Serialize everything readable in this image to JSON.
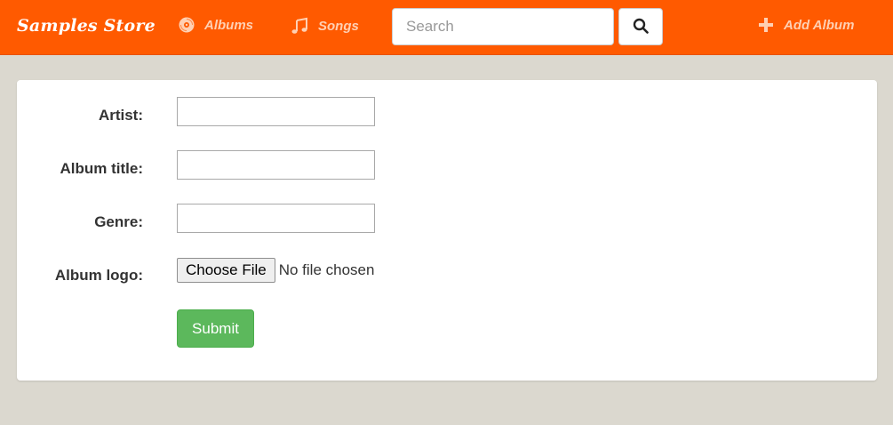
{
  "colors": {
    "navbar": "#ff5a00",
    "nav_link": "#ffd0b3",
    "background": "#dbd8cf",
    "submit": "#5cb85c"
  },
  "navbar": {
    "brand": "Samples Store",
    "links": [
      {
        "label": "Albums",
        "icon": "disc-icon"
      },
      {
        "label": "Songs",
        "icon": "music-note-icon"
      }
    ],
    "search": {
      "placeholder": "Search",
      "value": "",
      "button_icon": "search-icon"
    },
    "add_album": {
      "label": "Add Album",
      "icon": "plus-icon"
    }
  },
  "form": {
    "artist_label": "Artist:",
    "artist_value": "",
    "album_title_label": "Album title:",
    "album_title_value": "",
    "genre_label": "Genre:",
    "genre_value": "",
    "album_logo_label": "Album logo:",
    "file_button_label": "Choose File",
    "file_status": "No file chosen",
    "submit_label": "Submit"
  }
}
